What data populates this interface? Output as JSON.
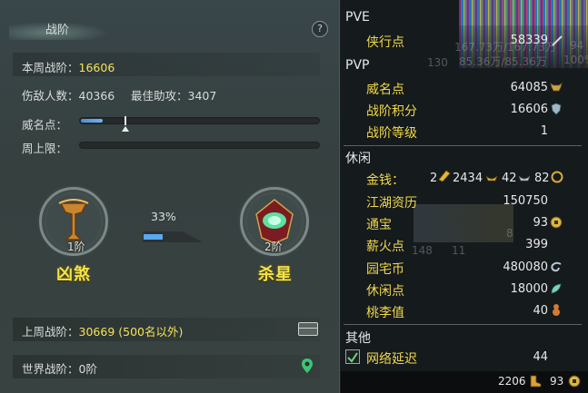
{
  "left_panel": {
    "title": "战阶",
    "help": "?",
    "weekly_label": "本周战阶：",
    "weekly_value": "16606",
    "injured_label": "伤敌人数：40366",
    "assist_label": "最佳助攻：3407",
    "prestige_label": "威名点：",
    "prestige_fill": 0.09,
    "weekly_cap_label": "周上限：",
    "current_rank": {
      "level": "1阶",
      "name": "凶煞"
    },
    "next_rank": {
      "level": "2阶",
      "name": "杀星"
    },
    "progress_percent": "33%",
    "progress_value": 0.33,
    "last_week_label": "上周战阶：",
    "last_week_value": "30669 (500名以外)",
    "world_label": "世界战阶：0阶"
  },
  "right_panel": {
    "bg_ghost": [
      "167.73万/167.73万",
      "130",
      "85.36万/85.36万",
      "100%",
      "148",
      "11",
      "8",
      "94"
    ],
    "pve": {
      "header": "PVE",
      "items": [
        {
          "label": "侠行点",
          "value": "58339",
          "icon": "sword-icon"
        }
      ]
    },
    "pvp": {
      "header": "PVP",
      "items": [
        {
          "label": "威名点",
          "value": "64085",
          "icon": "cow-head-icon"
        },
        {
          "label": "战阶积分",
          "value": "16606",
          "icon": "shield-icon"
        },
        {
          "label": "战阶等级",
          "value": "1",
          "icon": ""
        }
      ]
    },
    "leisure": {
      "header": "休闲",
      "money_label": "金钱：",
      "money_gold": "2",
      "money_silver": "2434",
      "money_copper1": "42",
      "money_copper2": "82",
      "items": [
        {
          "label": "江湖资历",
          "value": "150750",
          "icon": ""
        },
        {
          "label": "通宝",
          "value": "93",
          "icon": "coin-icon"
        },
        {
          "label": "薪火点",
          "value": "399",
          "icon": ""
        },
        {
          "label": "园宅币",
          "value": "480080",
          "icon": "swirl-icon"
        },
        {
          "label": "休闲点",
          "value": "18000",
          "icon": "leaf-icon"
        },
        {
          "label": "桃李值",
          "value": "40",
          "icon": "gourd-icon"
        }
      ]
    },
    "other": {
      "header": "其他",
      "items": [
        {
          "label": "网络延迟",
          "value": "44",
          "checked": true
        }
      ]
    },
    "bottom_bar": {
      "left_value": "2206",
      "right_value": "93"
    }
  }
}
